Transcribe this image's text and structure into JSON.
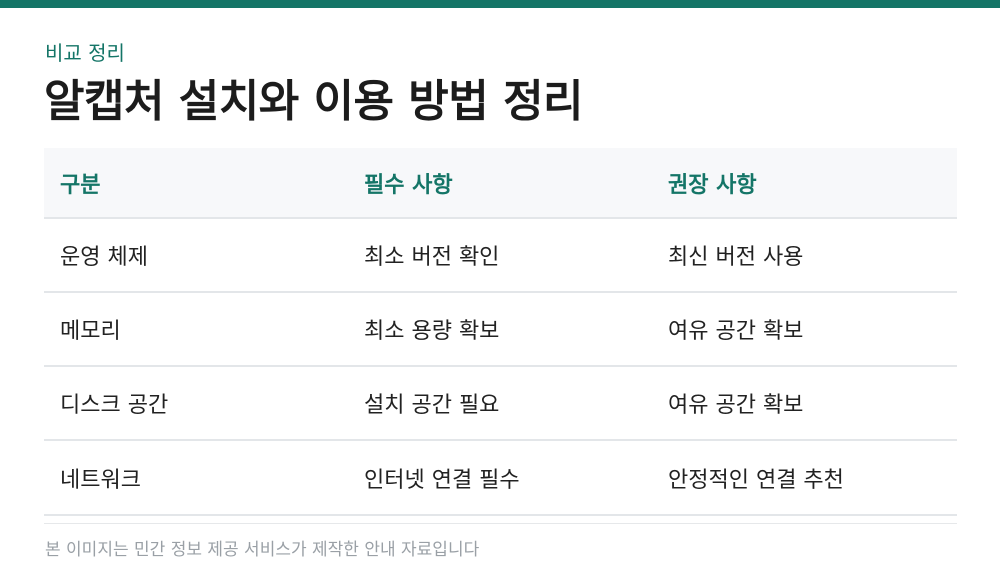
{
  "header": {
    "eyebrow": "비교 정리",
    "title": "알캡처 설치와 이용 방법 정리"
  },
  "table": {
    "columns": [
      "구분",
      "필수 사항",
      "권장 사항"
    ],
    "rows": [
      [
        "운영 체제",
        "최소 버전 확인",
        "최신 버전 사용"
      ],
      [
        "메모리",
        "최소 용량 확보",
        "여유 공간 확보"
      ],
      [
        "디스크 공간",
        "설치 공간 필요",
        "여유 공간 확보"
      ],
      [
        "네트워크",
        "인터넷 연결 필수",
        "안정적인 연결 추천"
      ]
    ]
  },
  "footer": {
    "note": "본 이미지는 민간 정보 제공 서비스가 제작한 안내 자료입니다"
  },
  "colors": {
    "accent": "#147567",
    "header_bg": "#f7f8fa",
    "divider": "#e3e6e9"
  }
}
